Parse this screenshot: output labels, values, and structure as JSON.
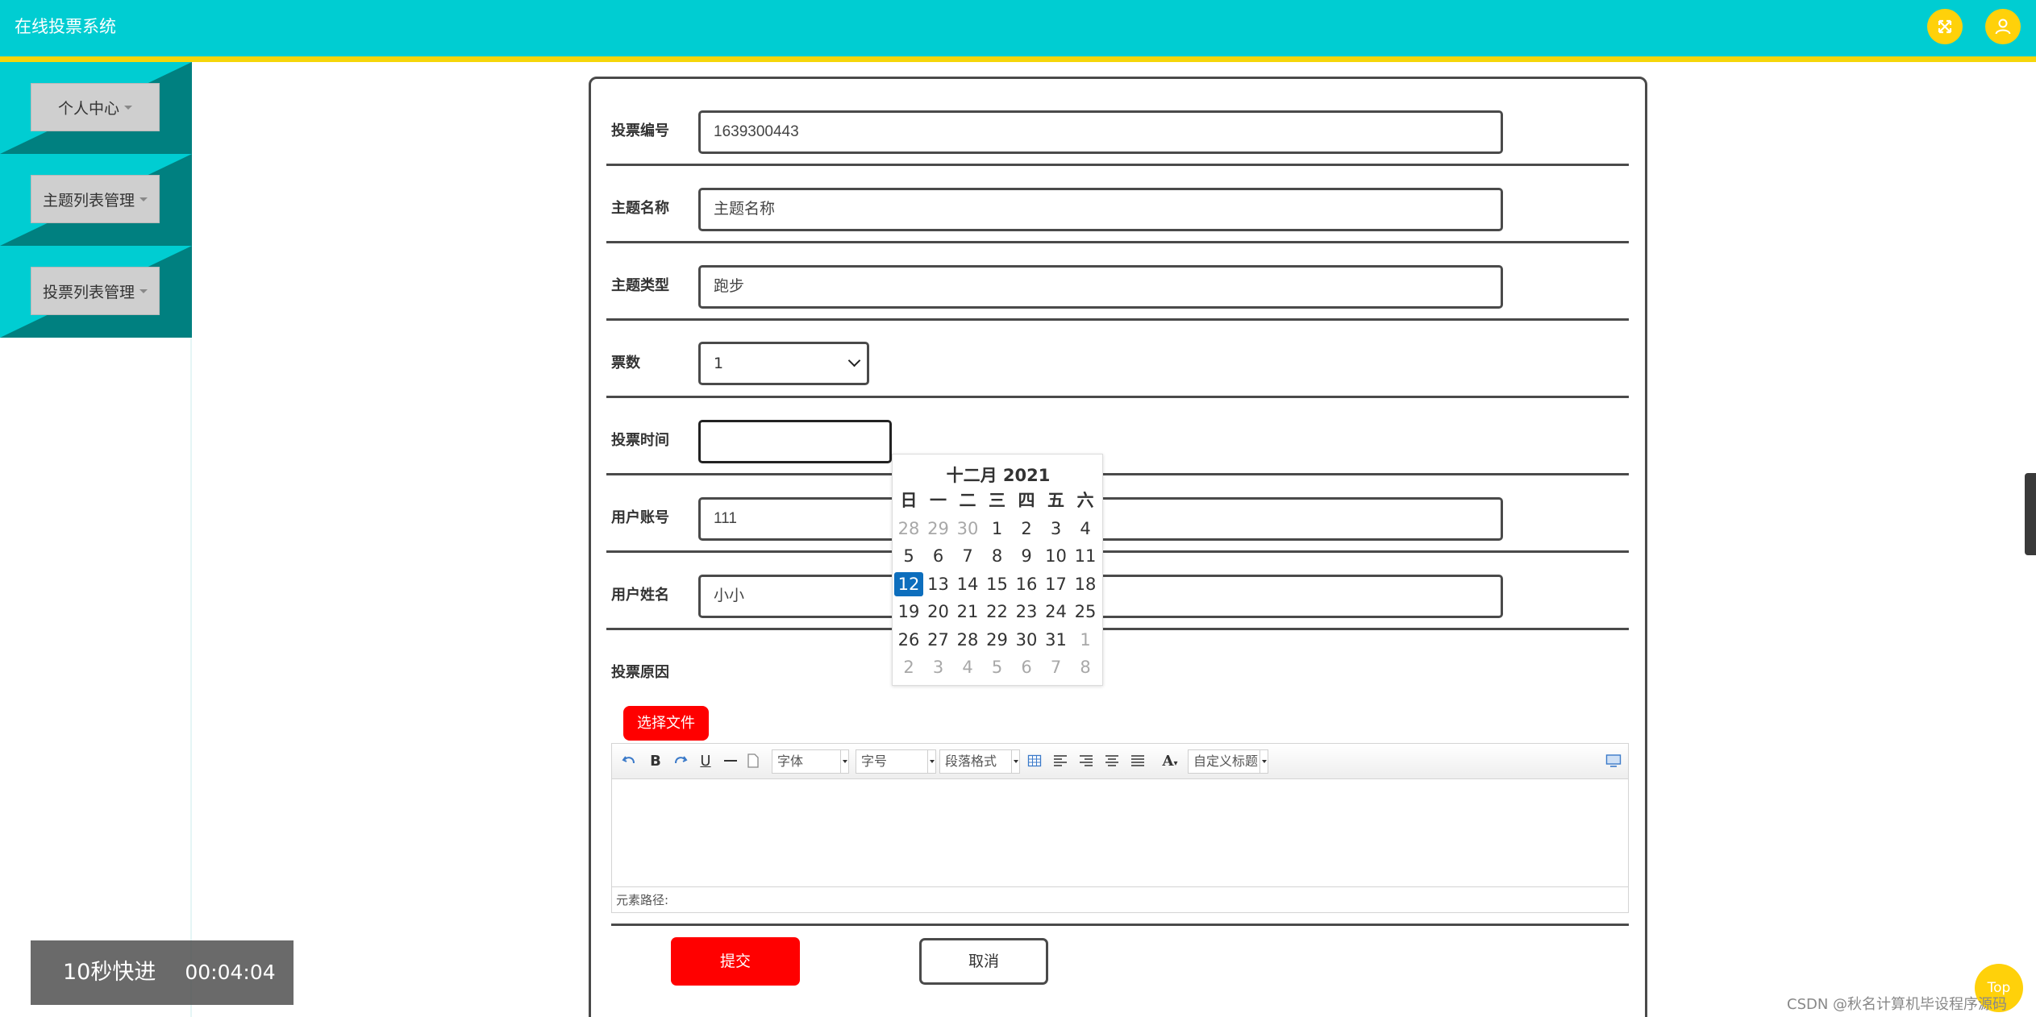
{
  "header": {
    "title": "在线投票系统",
    "accent_color": "#00cdd2",
    "strip_color": "#f5d60a",
    "icons": [
      "fullscreen-icon",
      "user-icon"
    ]
  },
  "sidebar": {
    "items": [
      {
        "label": "个人中心"
      },
      {
        "label": "主题列表管理"
      },
      {
        "label": "投票列表管理"
      }
    ]
  },
  "form": {
    "rows": [
      {
        "label": "投票编号",
        "value": "1639300443"
      },
      {
        "label": "主题名称",
        "value": "主题名称"
      },
      {
        "label": "主题类型",
        "value": "跑步"
      },
      {
        "label": "票数",
        "value": "1"
      },
      {
        "label": "投票时间",
        "value": ""
      },
      {
        "label": "用户账号",
        "value": "111"
      },
      {
        "label": "用户姓名",
        "value": "小小"
      },
      {
        "label": "投票原因"
      }
    ],
    "file_button": "选择文件",
    "submit": "提交",
    "cancel": "取消"
  },
  "calendar": {
    "title": "十二月 2021",
    "weekdays": [
      "日",
      "一",
      "二",
      "三",
      "四",
      "五",
      "六"
    ],
    "weeks": [
      [
        "28",
        "29",
        "30",
        "1",
        "2",
        "3",
        "4"
      ],
      [
        "5",
        "6",
        "7",
        "8",
        "9",
        "10",
        "11"
      ],
      [
        "12",
        "13",
        "14",
        "15",
        "16",
        "17",
        "18"
      ],
      [
        "19",
        "20",
        "21",
        "22",
        "23",
        "24",
        "25"
      ],
      [
        "26",
        "27",
        "28",
        "29",
        "30",
        "31",
        "1"
      ],
      [
        "2",
        "3",
        "4",
        "5",
        "6",
        "7",
        "8"
      ]
    ],
    "selected": "12",
    "selected_color": "#0d6ebd"
  },
  "editor": {
    "font_combo": "字体",
    "size_combo": "字号",
    "paragraph_combo": "段落格式",
    "text_color": "A",
    "custom_combo": "自定义标题",
    "status": "元素路径:"
  },
  "overlay": {
    "video_label": "10秒快进",
    "video_time": "00:04:04",
    "top_label": "Top",
    "watermark": "CSDN @秋名计算机毕设程序源码"
  }
}
